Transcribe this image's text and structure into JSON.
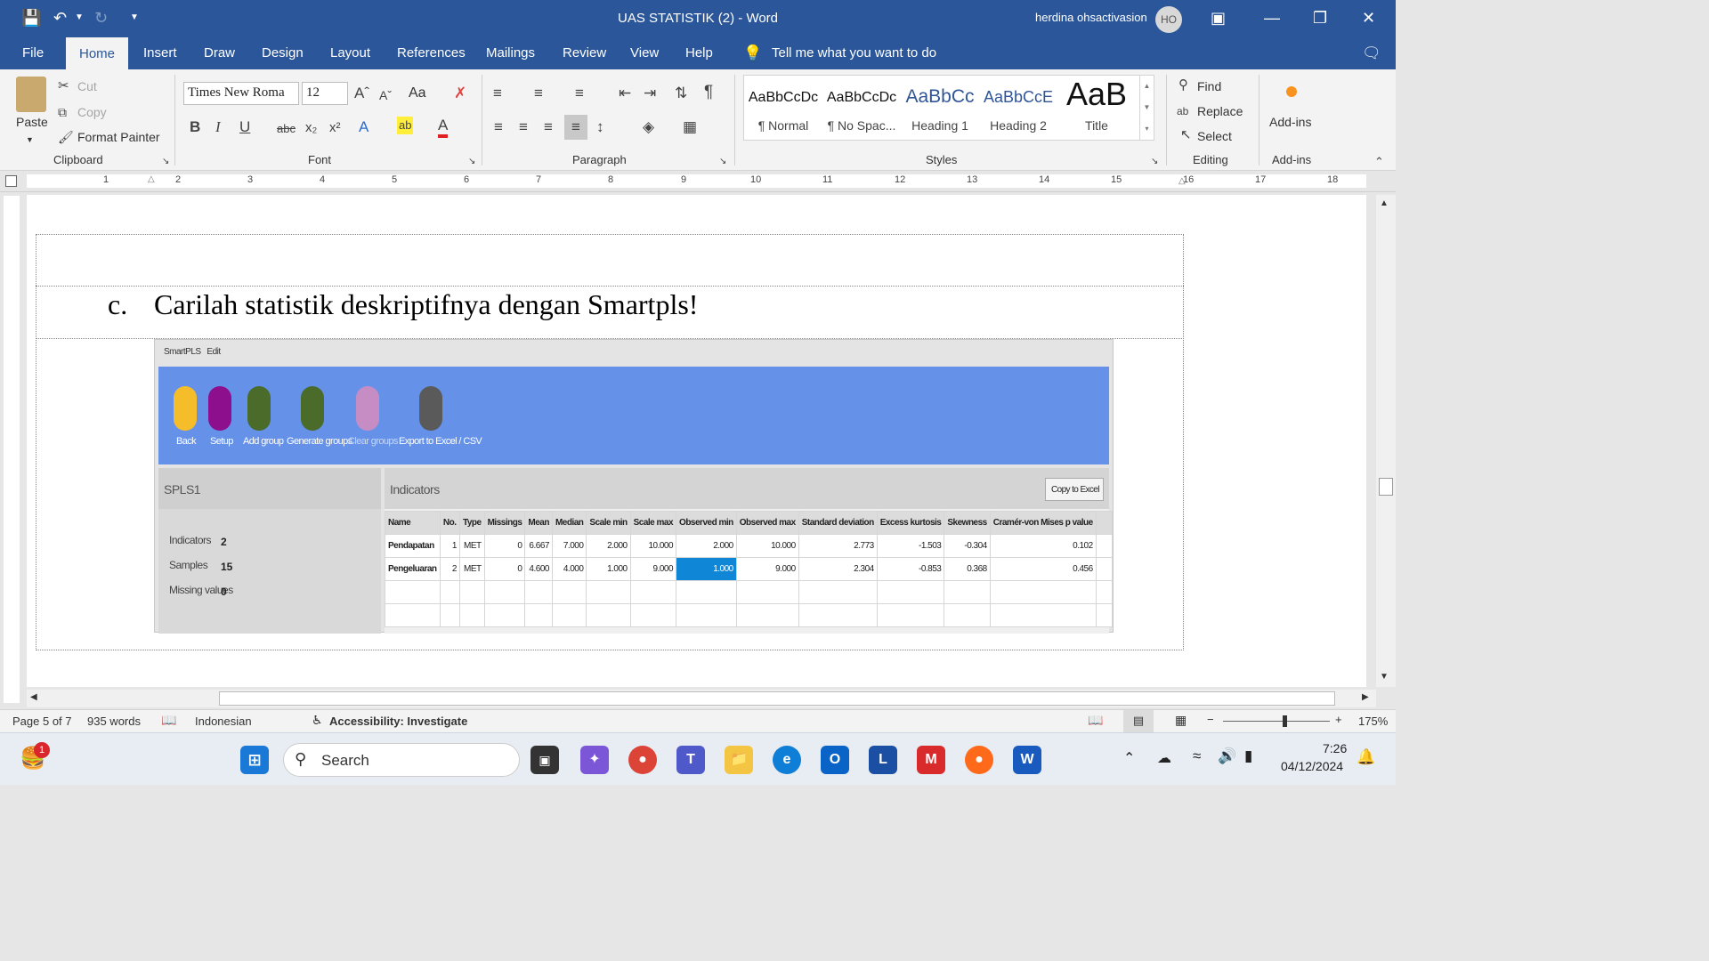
{
  "window": {
    "title": "UAS STATISTIK (2)  -  Word",
    "user_name": "herdina ohsactivasion",
    "user_initials": "HO"
  },
  "tabs": [
    "File",
    "Home",
    "Insert",
    "Draw",
    "Design",
    "Layout",
    "References",
    "Mailings",
    "Review",
    "View",
    "Help"
  ],
  "tell_me": "Tell me what you want to do",
  "clipboard": {
    "paste": "Paste",
    "cut": "Cut",
    "copy": "Copy",
    "format_painter": "Format Painter",
    "label": "Clipboard"
  },
  "font": {
    "name": "Times New Roma",
    "size": "12",
    "label": "Font",
    "change_case": "Aa"
  },
  "paragraph": {
    "label": "Paragraph"
  },
  "styles": {
    "label": "Styles",
    "items": [
      {
        "sample": "AaBbCcDc",
        "name": "¶ Normal"
      },
      {
        "sample": "AaBbCcDc",
        "name": "¶ No Spac..."
      },
      {
        "sample": "AaBbCc",
        "name": "Heading 1"
      },
      {
        "sample": "AaBbCcE",
        "name": "Heading 2"
      },
      {
        "sample": "AaB",
        "name": "Title"
      }
    ]
  },
  "editing": {
    "find": "Find",
    "replace": "Replace",
    "select": "Select",
    "label": "Editing"
  },
  "addins": {
    "button": "Add-ins",
    "label": "Add-ins"
  },
  "ruler_numbers": [
    "1",
    "2",
    "3",
    "4",
    "5",
    "6",
    "7",
    "8",
    "9",
    "10",
    "11",
    "12",
    "13",
    "14",
    "15",
    "16",
    "17",
    "18"
  ],
  "document": {
    "question_letter": "c.",
    "question_text": "Carilah statistik deskriptifnya dengan Smartpls!"
  },
  "smartpls": {
    "menu": [
      "SmartPLS",
      "Edit"
    ],
    "toolbar": [
      {
        "label": "Back",
        "color": "#f6bd2b"
      },
      {
        "label": "Setup",
        "color": "#8e0f8e"
      },
      {
        "label": "Add group",
        "color": "#4a6b2a"
      },
      {
        "label": "Generate groups",
        "color": "#4a6b2a"
      },
      {
        "label": "Clear groups",
        "color": "#c58dc3"
      },
      {
        "label": "Export to Excel / CSV",
        "color": "#5a5a5a"
      }
    ],
    "model_name": "SPLS1",
    "panel_title": "Indicators",
    "copy_button": "Copy to Excel",
    "summary": [
      {
        "label": "Indicators",
        "value": "2"
      },
      {
        "label": "Samples",
        "value": "15"
      },
      {
        "label": "Missing values",
        "value": "0"
      }
    ],
    "columns": [
      "Name",
      "No.",
      "Type",
      "Missings",
      "Mean",
      "Median",
      "Scale min",
      "Scale max",
      "Observed min",
      "Observed max",
      "Standard deviation",
      "Excess kurtosis",
      "Skewness",
      "Cramér-von Mises p value"
    ],
    "rows": [
      [
        "Pendapatan",
        "1",
        "MET",
        "0",
        "6.667",
        "7.000",
        "2.000",
        "10.000",
        "2.000",
        "10.000",
        "2.773",
        "-1.503",
        "-0.304",
        "0.102"
      ],
      [
        "Pengeluaran",
        "2",
        "MET",
        "0",
        "4.600",
        "4.000",
        "1.000",
        "9.000",
        "1.000",
        "9.000",
        "2.304",
        "-0.853",
        "0.368",
        "0.456"
      ]
    ]
  },
  "status": {
    "page": "Page 5 of 7",
    "words": "935 words",
    "language": "Indonesian",
    "accessibility": "Accessibility: Investigate",
    "zoom": "175%"
  },
  "taskbar": {
    "search": "Search",
    "time": "7:26",
    "date": "04/12/2024",
    "notification_badge": "1"
  }
}
